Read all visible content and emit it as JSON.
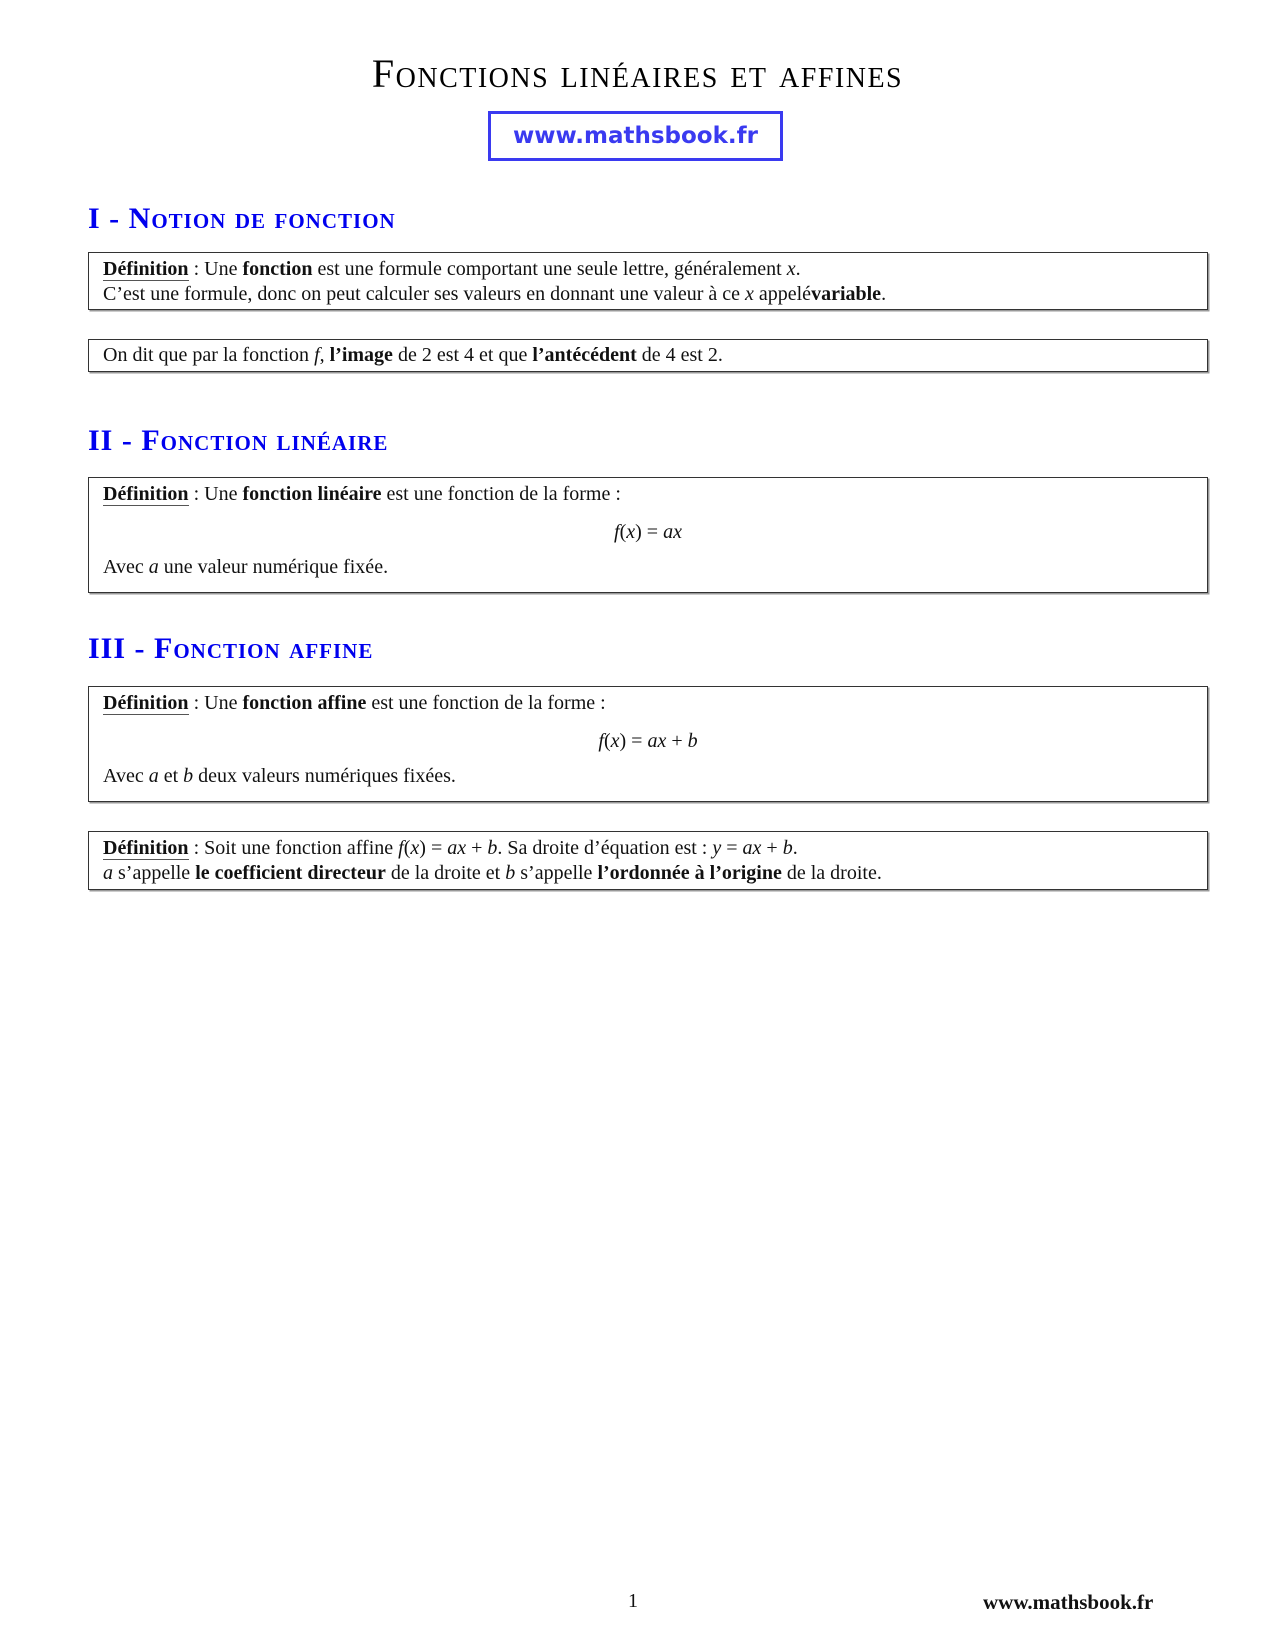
{
  "document": {
    "title": "Fonctions linéaires et affines",
    "logo_text": "www.mathsbook.fr",
    "accent_color": "#0000ee",
    "logo_color": "#3a3af0"
  },
  "sections": [
    {
      "heading": "I - Notion de fonction",
      "blocks": [
        {
          "label": "Définition",
          "line1": [
            " : Une ",
            "fonction",
            " est une formule comportant une seule lettre, généralement ",
            "x",
            "."
          ],
          "line2": [
            "C’est une formule, donc on peut calculer ses valeurs en donnant une valeur à ce ",
            "x",
            " appelé",
            "variable",
            "."
          ]
        },
        {
          "line1": [
            "On dit que par la fonction ",
            "f",
            ", ",
            "l’image",
            " de 2 est 4 et que ",
            "l’antécédent",
            " de 4 est 2."
          ]
        }
      ]
    },
    {
      "heading": "II - Fonction linéaire",
      "blocks": [
        {
          "label": "Définition",
          "line1": [
            " : Une ",
            "fonction linéaire",
            " est une fonction de la forme :"
          ],
          "formula": [
            "f",
            "(",
            "x",
            ") = ",
            "ax"
          ],
          "line2": [
            "Avec ",
            "a",
            " une valeur numérique fixée."
          ]
        }
      ]
    },
    {
      "heading": "III - Fonction affine",
      "blocks": [
        {
          "label": "Définition",
          "line1": [
            " : Une ",
            "fonction affine",
            " est une fonction de la forme :"
          ],
          "formula": [
            "f",
            "(",
            "x",
            ") = ",
            "ax",
            " + ",
            "b"
          ],
          "line2": [
            "Avec ",
            "a",
            " et ",
            "b",
            " deux valeurs numériques fixées."
          ]
        },
        {
          "label": "Définition",
          "line1": [
            " : Soit une fonction affine ",
            "f",
            "(",
            "x",
            ") = ",
            "ax",
            " + ",
            "b",
            ". Sa droite d’équation est : ",
            "y",
            " = ",
            "ax",
            " + ",
            "b",
            "."
          ],
          "line2": [
            "a",
            " s’appelle ",
            "le coefficient directeur",
            " de la droite et ",
            "b",
            " s’appelle ",
            "l’ordonnée à l’origine",
            " de la droite."
          ]
        }
      ]
    }
  ],
  "footer": {
    "page_number": "1",
    "site": "www.mathsbook.fr"
  }
}
